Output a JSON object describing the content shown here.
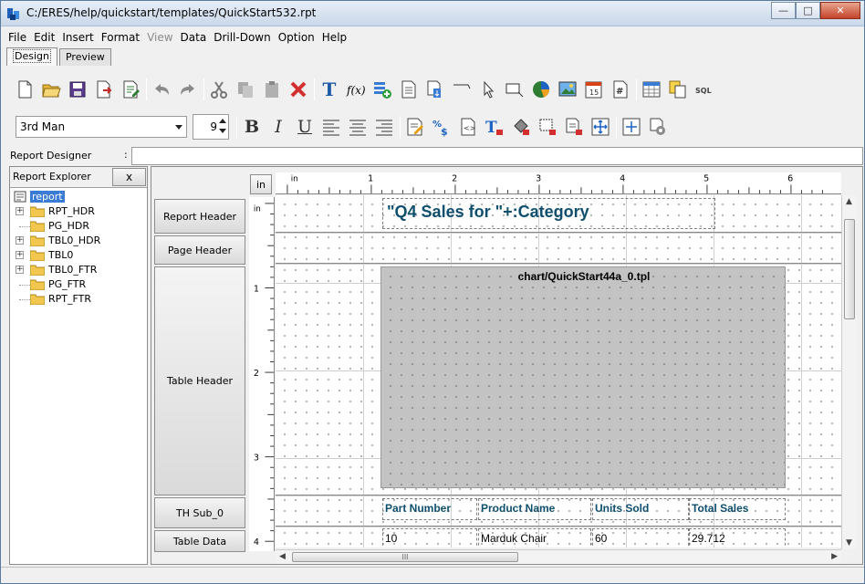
{
  "window": {
    "title": "C:/ERES/help/quickstart/templates/QuickStart532.rpt"
  },
  "menu": [
    "File",
    "Edit",
    "Insert",
    "Format",
    "View",
    "Data",
    "Drill-Down",
    "Option",
    "Help"
  ],
  "tabs": {
    "design": "Design",
    "preview": "Preview"
  },
  "format_bar": {
    "font": "3rd Man",
    "size": "9",
    "bold": "B",
    "italic": "I",
    "underline": "U"
  },
  "designer_bar": {
    "label": "Report Designer",
    "colon": ":"
  },
  "explorer": {
    "title": "Report Explorer",
    "close": "x",
    "root": "report",
    "items": [
      "RPT_HDR",
      "PG_HDR",
      "TBL0_HDR",
      "TBL0",
      "TBL0_FTR",
      "PG_FTR",
      "RPT_FTR"
    ]
  },
  "design": {
    "unit_button": "in",
    "bands": [
      "Report Header",
      "Page Header",
      "Table Header",
      "TH Sub_0",
      "Table Data"
    ],
    "ruler_h": [
      "in",
      "1",
      "2",
      "3",
      "4",
      "5",
      "6"
    ],
    "ruler_v": [
      "in",
      "1",
      "2",
      "3",
      "4"
    ],
    "title_formula": "\"Q4 Sales for \"+:Category",
    "chart_file": "chart/QuickStart44a_0.tpl",
    "columns": [
      "Part Number",
      "Product Name",
      "Units Sold",
      "Total Sales"
    ],
    "row": [
      "10",
      "Marduk Chair",
      "60",
      "29.712"
    ],
    "scroll_grip": "III"
  }
}
